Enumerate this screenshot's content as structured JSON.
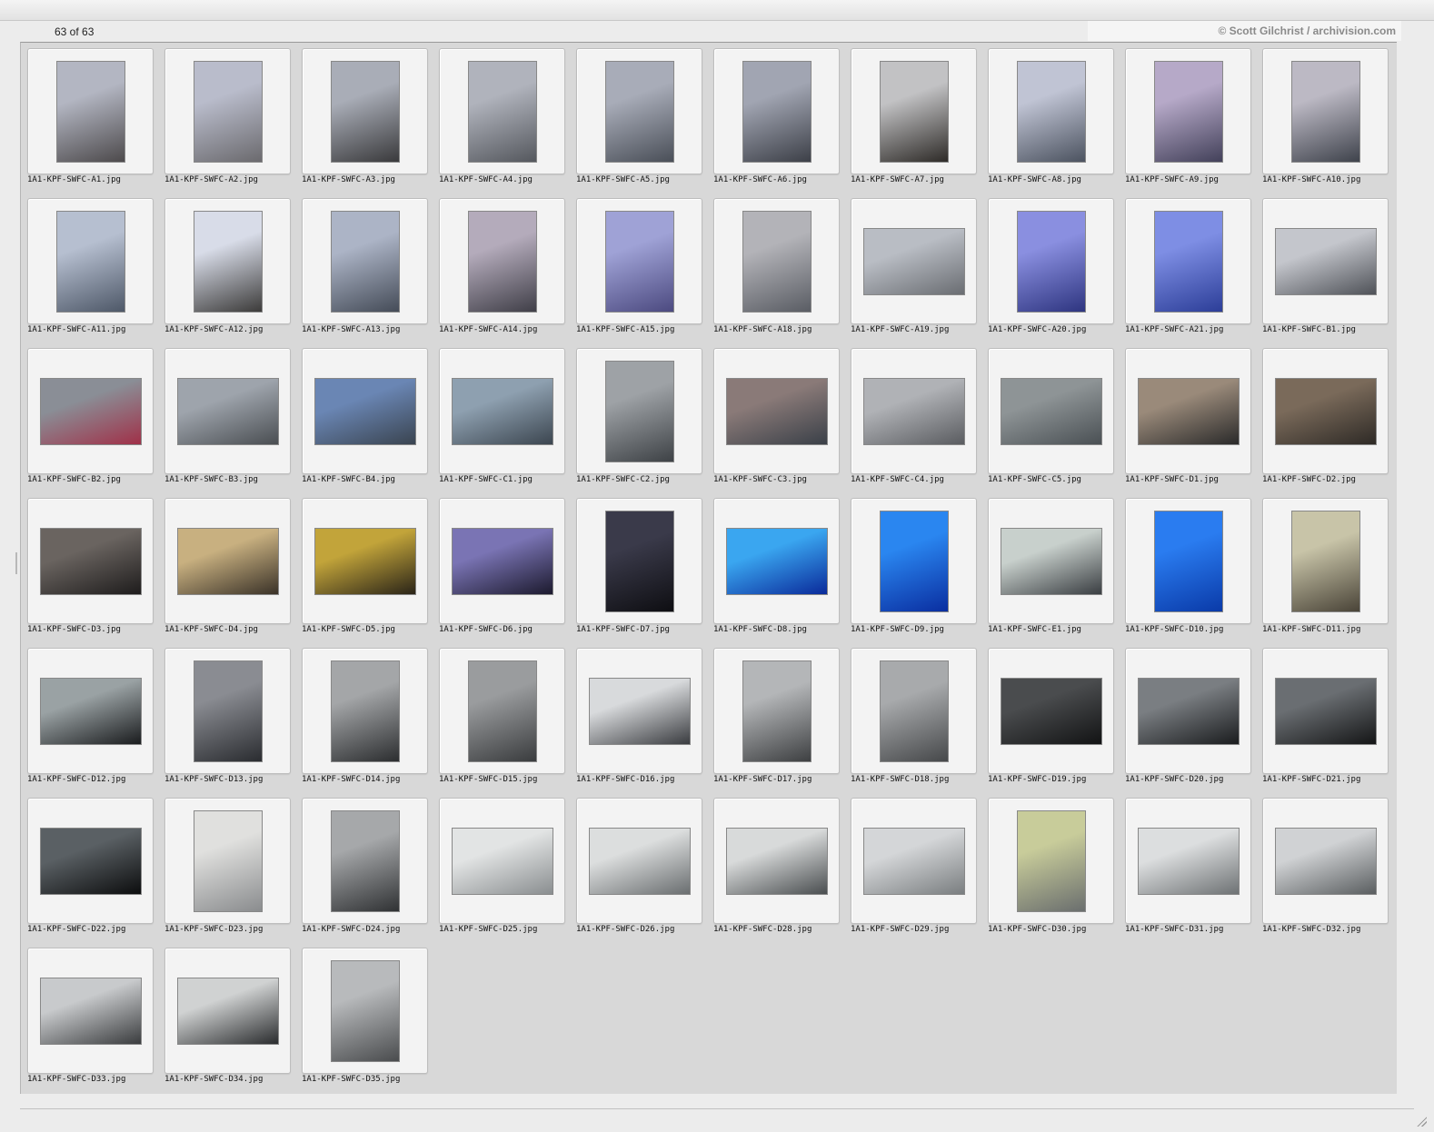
{
  "header": {
    "count_label": "63 of 63",
    "credit": "© Scott Gilchrist / archivision.com"
  },
  "items": [
    {
      "name": "1A1-KPF-SWFC-A1.jpg",
      "orient": "portrait",
      "c1": "#b3b6c2",
      "c2": "#4d4a4c"
    },
    {
      "name": "1A1-KPF-SWFC-A2.jpg",
      "orient": "portrait",
      "c1": "#b9bccb",
      "c2": "#6b6a6e"
    },
    {
      "name": "1A1-KPF-SWFC-A3.jpg",
      "orient": "portrait",
      "c1": "#a9adb7",
      "c2": "#3a3a3c"
    },
    {
      "name": "1A1-KPF-SWFC-A4.jpg",
      "orient": "portrait",
      "c1": "#b0b3bc",
      "c2": "#55585e"
    },
    {
      "name": "1A1-KPF-SWFC-A5.jpg",
      "orient": "portrait",
      "c1": "#a8acb8",
      "c2": "#4a4f58"
    },
    {
      "name": "1A1-KPF-SWFC-A6.jpg",
      "orient": "portrait",
      "c1": "#a1a5b2",
      "c2": "#3d4048"
    },
    {
      "name": "1A1-KPF-SWFC-A7.jpg",
      "orient": "portrait",
      "c1": "#c2c2c4",
      "c2": "#2e2b28"
    },
    {
      "name": "1A1-KPF-SWFC-A8.jpg",
      "orient": "portrait",
      "c1": "#c0c4d4",
      "c2": "#4c5360"
    },
    {
      "name": "1A1-KPF-SWFC-A9.jpg",
      "orient": "portrait",
      "c1": "#b6a9c8",
      "c2": "#43415a"
    },
    {
      "name": "1A1-KPF-SWFC-A10.jpg",
      "orient": "portrait",
      "c1": "#bcb9c4",
      "c2": "#3f434c"
    },
    {
      "name": "1A1-KPF-SWFC-A11.jpg",
      "orient": "portrait",
      "c1": "#b6bfd0",
      "c2": "#4e5868"
    },
    {
      "name": "1A1-KPF-SWFC-A12.jpg",
      "orient": "portrait",
      "c1": "#d8dce8",
      "c2": "#3c3b3a"
    },
    {
      "name": "1A1-KPF-SWFC-A13.jpg",
      "orient": "portrait",
      "c1": "#acb4c6",
      "c2": "#454c58"
    },
    {
      "name": "1A1-KPF-SWFC-A14.jpg",
      "orient": "portrait",
      "c1": "#b4abbb",
      "c2": "#403f48"
    },
    {
      "name": "1A1-KPF-SWFC-A15.jpg",
      "orient": "portrait",
      "c1": "#9fa2d6",
      "c2": "#4c4a80"
    },
    {
      "name": "1A1-KPF-SWFC-A18.jpg",
      "orient": "portrait",
      "c1": "#b3b3b8",
      "c2": "#5a5d64"
    },
    {
      "name": "1A1-KPF-SWFC-A19.jpg",
      "orient": "landscape",
      "c1": "#b9bdc4",
      "c2": "#6a6d72"
    },
    {
      "name": "1A1-KPF-SWFC-A20.jpg",
      "orient": "portrait",
      "c1": "#8a8fe0",
      "c2": "#2e3580"
    },
    {
      "name": "1A1-KPF-SWFC-A21.jpg",
      "orient": "portrait",
      "c1": "#7e8ee4",
      "c2": "#2c3e98"
    },
    {
      "name": "1A1-KPF-SWFC-B1.jpg",
      "orient": "landscape",
      "c1": "#c4c6cc",
      "c2": "#4f5258"
    },
    {
      "name": "1A1-KPF-SWFC-B2.jpg",
      "orient": "landscape",
      "c1": "#8a8e96",
      "c2": "#a03048"
    },
    {
      "name": "1A1-KPF-SWFC-B3.jpg",
      "orient": "landscape",
      "c1": "#9ea4ac",
      "c2": "#4a4e52"
    },
    {
      "name": "1A1-KPF-SWFC-B4.jpg",
      "orient": "landscape",
      "c1": "#6a86b4",
      "c2": "#3a4450"
    },
    {
      "name": "1A1-KPF-SWFC-C1.jpg",
      "orient": "landscape",
      "c1": "#8ea0b0",
      "c2": "#3c4650"
    },
    {
      "name": "1A1-KPF-SWFC-C2.jpg",
      "orient": "portrait",
      "c1": "#9ea2a6",
      "c2": "#3e4246"
    },
    {
      "name": "1A1-KPF-SWFC-C3.jpg",
      "orient": "landscape",
      "c1": "#8a7a78",
      "c2": "#3a4048"
    },
    {
      "name": "1A1-KPF-SWFC-C4.jpg",
      "orient": "landscape",
      "c1": "#b0b2b6",
      "c2": "#5a5c60"
    },
    {
      "name": "1A1-KPF-SWFC-C5.jpg",
      "orient": "landscape",
      "c1": "#8e9496",
      "c2": "#4a5054"
    },
    {
      "name": "1A1-KPF-SWFC-D1.jpg",
      "orient": "landscape",
      "c1": "#9a8a7a",
      "c2": "#2a2a2a"
    },
    {
      "name": "1A1-KPF-SWFC-D2.jpg",
      "orient": "landscape",
      "c1": "#7a6a5a",
      "c2": "#2e2a26"
    },
    {
      "name": "1A1-KPF-SWFC-D3.jpg",
      "orient": "landscape",
      "c1": "#6a6460",
      "c2": "#1e1c1c"
    },
    {
      "name": "1A1-KPF-SWFC-D4.jpg",
      "orient": "landscape",
      "c1": "#c8b080",
      "c2": "#3a3228"
    },
    {
      "name": "1A1-KPF-SWFC-D5.jpg",
      "orient": "landscape",
      "c1": "#c2a43a",
      "c2": "#2a2418"
    },
    {
      "name": "1A1-KPF-SWFC-D6.jpg",
      "orient": "landscape",
      "c1": "#7a74b4",
      "c2": "#1c1a2e"
    },
    {
      "name": "1A1-KPF-SWFC-D7.jpg",
      "orient": "portrait",
      "c1": "#3a3a4a",
      "c2": "#0e0e12"
    },
    {
      "name": "1A1-KPF-SWFC-D8.jpg",
      "orient": "landscape",
      "c1": "#3aa6f0",
      "c2": "#0a2a9a"
    },
    {
      "name": "1A1-KPF-SWFC-D9.jpg",
      "orient": "portrait",
      "c1": "#2a86f0",
      "c2": "#0a2ea0"
    },
    {
      "name": "1A1-KPF-SWFC-E1.jpg",
      "orient": "landscape",
      "c1": "#c8d0cc",
      "c2": "#3a3e42"
    },
    {
      "name": "1A1-KPF-SWFC-D10.jpg",
      "orient": "portrait",
      "c1": "#2a7cf0",
      "c2": "#0a3aa8"
    },
    {
      "name": "1A1-KPF-SWFC-D11.jpg",
      "orient": "portrait",
      "c1": "#c8c4a8",
      "c2": "#4a4438"
    },
    {
      "name": "1A1-KPF-SWFC-D12.jpg",
      "orient": "landscape",
      "c1": "#9aa2a4",
      "c2": "#1a1c1e"
    },
    {
      "name": "1A1-KPF-SWFC-D13.jpg",
      "orient": "portrait",
      "c1": "#8a8c92",
      "c2": "#2a2c30"
    },
    {
      "name": "1A1-KPF-SWFC-D14.jpg",
      "orient": "portrait",
      "c1": "#a4a6a8",
      "c2": "#2c2e30"
    },
    {
      "name": "1A1-KPF-SWFC-D15.jpg",
      "orient": "portrait",
      "c1": "#9a9c9e",
      "c2": "#3a3c3e"
    },
    {
      "name": "1A1-KPF-SWFC-D16.jpg",
      "orient": "landscape",
      "c1": "#d8dadc",
      "c2": "#3a3c40"
    },
    {
      "name": "1A1-KPF-SWFC-D17.jpg",
      "orient": "portrait",
      "c1": "#b4b6b8",
      "c2": "#3e4042"
    },
    {
      "name": "1A1-KPF-SWFC-D18.jpg",
      "orient": "portrait",
      "c1": "#a8aaac",
      "c2": "#46484a"
    },
    {
      "name": "1A1-KPF-SWFC-D19.jpg",
      "orient": "landscape",
      "c1": "#4a4c4e",
      "c2": "#121314"
    },
    {
      "name": "1A1-KPF-SWFC-D20.jpg",
      "orient": "landscape",
      "c1": "#7a7e82",
      "c2": "#1a1c1e"
    },
    {
      "name": "1A1-KPF-SWFC-D21.jpg",
      "orient": "landscape",
      "c1": "#6a6e72",
      "c2": "#141516"
    },
    {
      "name": "1A1-KPF-SWFC-D22.jpg",
      "orient": "landscape",
      "c1": "#5a6064",
      "c2": "#0c0d0e"
    },
    {
      "name": "1A1-KPF-SWFC-D23.jpg",
      "orient": "portrait",
      "c1": "#e0e0de",
      "c2": "#8a8c8e"
    },
    {
      "name": "1A1-KPF-SWFC-D24.jpg",
      "orient": "portrait",
      "c1": "#a6a8aa",
      "c2": "#303234"
    },
    {
      "name": "1A1-KPF-SWFC-D25.jpg",
      "orient": "landscape",
      "c1": "#e2e4e4",
      "c2": "#8a8e90"
    },
    {
      "name": "1A1-KPF-SWFC-D26.jpg",
      "orient": "landscape",
      "c1": "#dcdede",
      "c2": "#6a6e70"
    },
    {
      "name": "1A1-KPF-SWFC-D28.jpg",
      "orient": "landscape",
      "c1": "#d8dada",
      "c2": "#4a4e50"
    },
    {
      "name": "1A1-KPF-SWFC-D29.jpg",
      "orient": "landscape",
      "c1": "#d4d6d8",
      "c2": "#7a7e80"
    },
    {
      "name": "1A1-KPF-SWFC-D30.jpg",
      "orient": "portrait",
      "c1": "#c8cc9a",
      "c2": "#6a6e6e"
    },
    {
      "name": "1A1-KPF-SWFC-D31.jpg",
      "orient": "landscape",
      "c1": "#dcdedf",
      "c2": "#6e7274"
    },
    {
      "name": "1A1-KPF-SWFC-D32.jpg",
      "orient": "landscape",
      "c1": "#d0d2d4",
      "c2": "#5a5e60"
    },
    {
      "name": "1A1-KPF-SWFC-D33.jpg",
      "orient": "landscape",
      "c1": "#c8cacc",
      "c2": "#3a3c3e"
    },
    {
      "name": "1A1-KPF-SWFC-D34.jpg",
      "orient": "landscape",
      "c1": "#d0d2d2",
      "c2": "#2a2c2e"
    },
    {
      "name": "1A1-KPF-SWFC-D35.jpg",
      "orient": "portrait",
      "c1": "#b8babc",
      "c2": "#4a4c4e"
    }
  ]
}
